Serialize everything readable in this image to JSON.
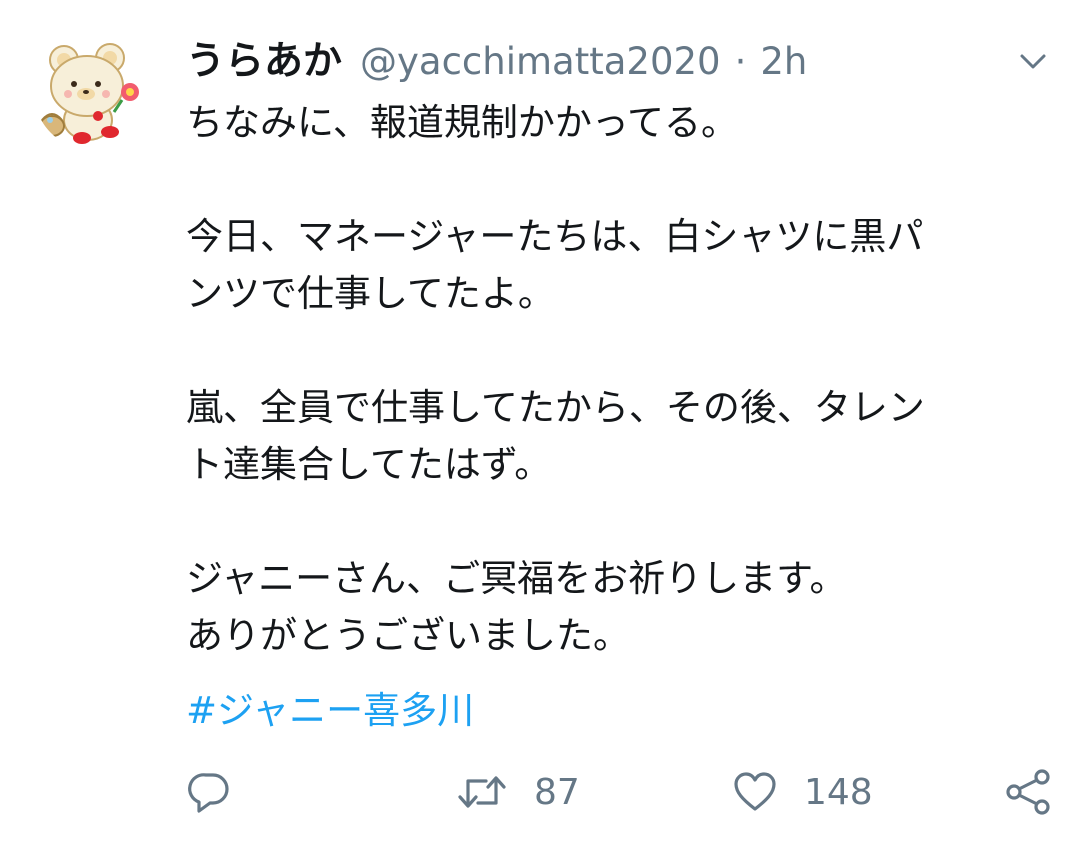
{
  "tweet": {
    "display_name": "うらあか",
    "handle": "@yacchimatta2020",
    "separator": "·",
    "time": "2h",
    "lines": {
      "l1": "ちなみに、報道規制かかってる。",
      "l2": "今日、マネージャーたちは、白シャツに黒パ",
      "l3": "ンツで仕事してたよ。",
      "l4": "嵐、全員で仕事してたから、その後、タレン",
      "l5": "ト達集合してたはず。",
      "l6": "ジャニーさん、ご冥福をお祈りします。",
      "l7": "ありがとうございました。"
    },
    "hashtag": "#ジャニー喜多川",
    "retweet_count": "87",
    "like_count": "148"
  },
  "icons": {
    "avatar": "bear-character-avatar",
    "menu": "chevron-down-icon",
    "reply": "reply-icon",
    "retweet": "retweet-icon",
    "like": "heart-icon",
    "share": "share-icon"
  },
  "colors": {
    "text": "#14171a",
    "secondary": "#657786",
    "link": "#1da1f2"
  }
}
